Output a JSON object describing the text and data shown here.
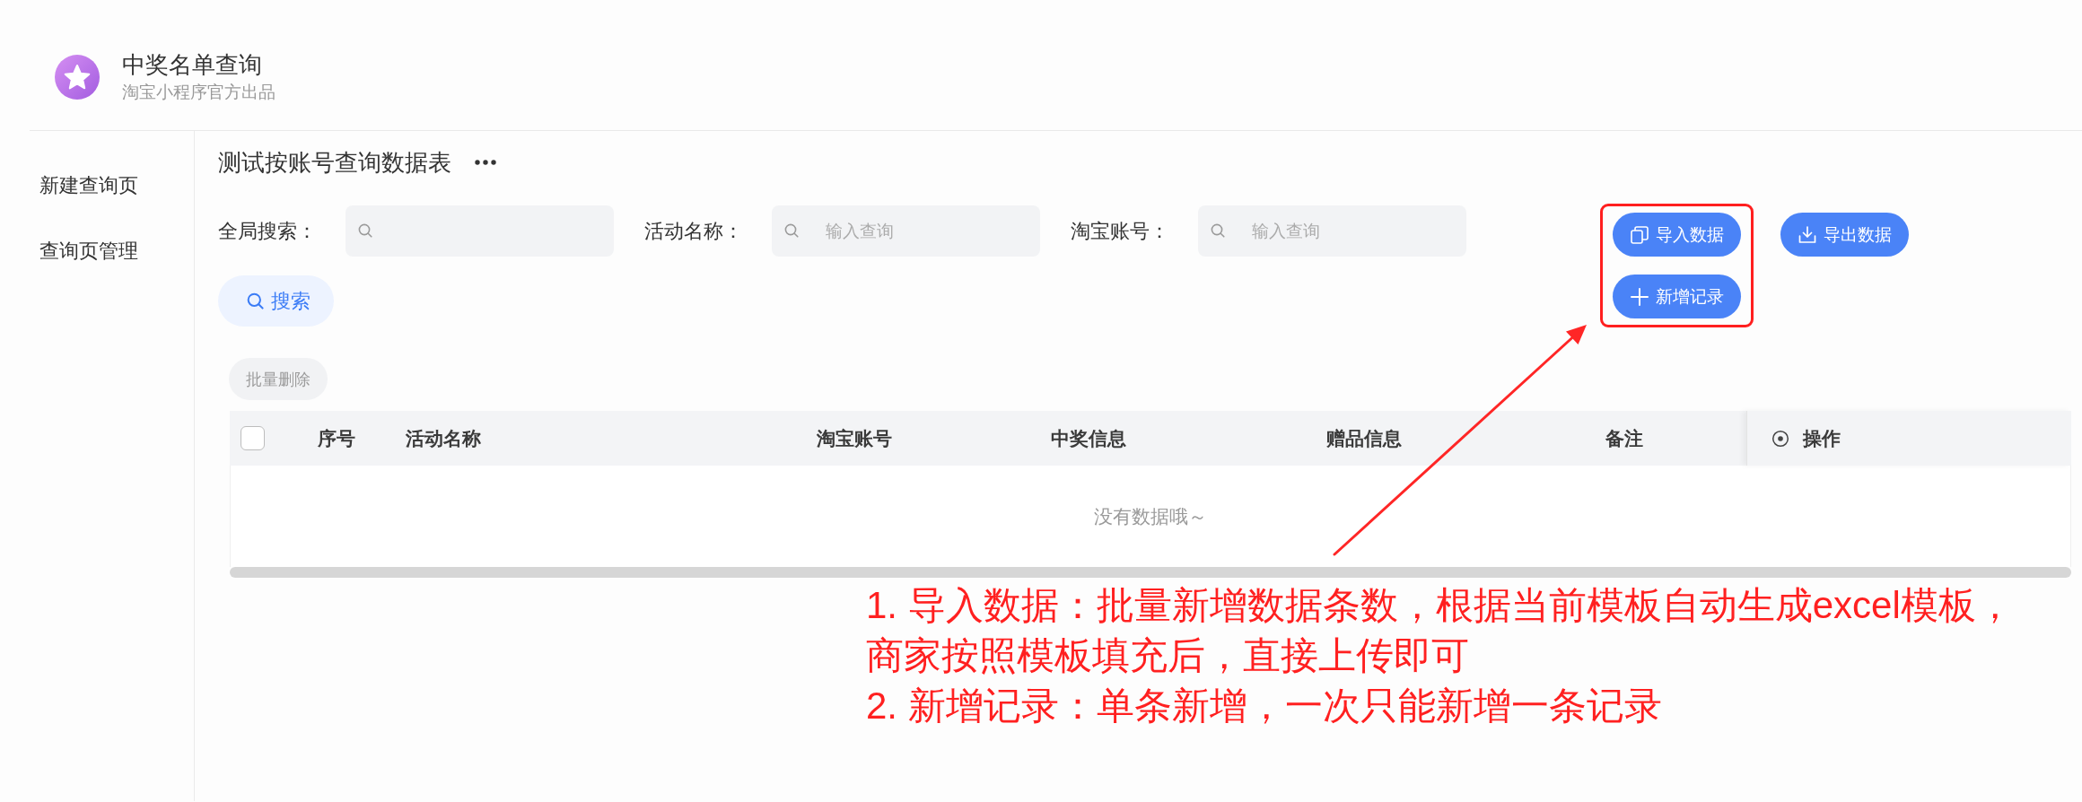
{
  "app": {
    "title": "中奖名单查询",
    "subtitle": "淘宝小程序官方出品"
  },
  "sidebar": {
    "items": [
      {
        "label": "新建查询页",
        "selected": false
      },
      {
        "label": "查询页管理",
        "selected": false
      }
    ]
  },
  "page": {
    "title": "测试按账号查询数据表"
  },
  "filters": [
    {
      "label": "全局搜索："
    },
    {
      "label": "活动名称：",
      "placeholder": "输入查询"
    },
    {
      "label": "淘宝账号：",
      "placeholder": "输入查询"
    }
  ],
  "search_button": {
    "label": "搜索"
  },
  "action_groups": [
    {
      "highlighted": true,
      "buttons": [
        {
          "kind": "import",
          "label": "导入数据"
        },
        {
          "kind": "add",
          "label": "新增记录"
        }
      ]
    },
    {
      "highlighted": false,
      "buttons": [
        {
          "kind": "export",
          "label": "导出数据"
        }
      ]
    }
  ],
  "bulk_delete": {
    "label": "批量删除",
    "disabled": true
  },
  "table": {
    "select_all": {
      "checked": false
    },
    "columns": [
      {
        "kind": "data",
        "label": "序号"
      },
      {
        "kind": "data",
        "label": "活动名称"
      },
      {
        "kind": "data",
        "label": "淘宝账号"
      },
      {
        "kind": "data",
        "label": "中奖信息"
      },
      {
        "kind": "data",
        "label": "赠品信息"
      },
      {
        "kind": "data",
        "label": "备注"
      },
      {
        "kind": "actions",
        "label": "操作"
      }
    ],
    "empty_text": "没有数据哦～"
  },
  "annotation": {
    "notes": [
      "1. 导入数据：批量新增数据条数，根据当前模板自动生成excel模板，商家按照模板填充后，直接上传即可",
      "2. 新增记录：单条新增，一次只能新增一条记录"
    ]
  }
}
